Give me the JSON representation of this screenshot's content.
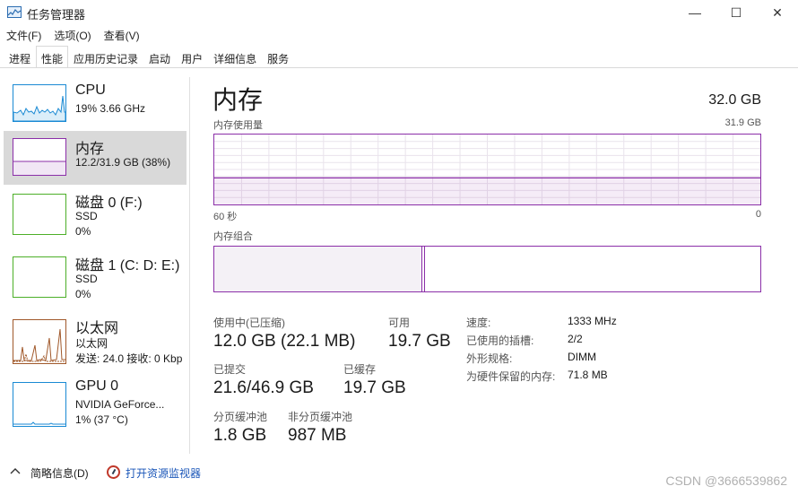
{
  "window": {
    "title": "任务管理器",
    "min_glyph": "—",
    "max_glyph": "☐",
    "close_glyph": "✕"
  },
  "menu": [
    "文件(F)",
    "选项(O)",
    "查看(V)"
  ],
  "tabs": [
    "进程",
    "性能",
    "应用历史记录",
    "启动",
    "用户",
    "详细信息",
    "服务"
  ],
  "active_tab": "性能",
  "sidebar": {
    "items": [
      {
        "title": "CPU",
        "lines": [
          "19% 3.66 GHz"
        ],
        "color": "#1a8ad4"
      },
      {
        "title": "内存",
        "lines": [
          "12.2/31.9 GB (38%)"
        ],
        "color": "#8b2fa8"
      },
      {
        "title": "磁盘 0 (F:)",
        "lines": [
          "SSD",
          "0%"
        ],
        "color": "#4caf28"
      },
      {
        "title": "磁盘 1 (C: D: E:)",
        "lines": [
          "SSD",
          "0%"
        ],
        "color": "#4caf28"
      },
      {
        "title": "以太网",
        "lines": [
          "以太网",
          "发送: 24.0  接收: 0 Kbp"
        ],
        "color": "#a0582a"
      },
      {
        "title": "GPU 0",
        "lines": [
          "NVIDIA GeForce...",
          "1% (37 °C)"
        ],
        "color": "#1a8ad4"
      }
    ],
    "selected": 1
  },
  "memory": {
    "title": "内存",
    "total": "32.0 GB",
    "usage_label": "内存使用量",
    "usage_max": "31.9 GB",
    "time_left": "60 秒",
    "time_right": "0",
    "usage_fraction": 0.38,
    "composition_label": "内存组合",
    "in_use_label": "使用中(已压缩)",
    "in_use_value": "12.0 GB (22.1 MB)",
    "available_label": "可用",
    "available_value": "19.7 GB",
    "committed_label": "已提交",
    "committed_value": "21.6/46.9 GB",
    "cached_label": "已缓存",
    "cached_value": "19.7 GB",
    "paged_label": "分页缓冲池",
    "paged_value": "1.8 GB",
    "nonpaged_label": "非分页缓冲池",
    "nonpaged_value": "987 MB",
    "info": [
      {
        "label": "速度:",
        "value": "1333 MHz"
      },
      {
        "label": "已使用的插槽:",
        "value": "2/2"
      },
      {
        "label": "外形规格:",
        "value": "DIMM"
      },
      {
        "label": "为硬件保留的内存:",
        "value": "71.8 MB"
      }
    ]
  },
  "footer": {
    "summary": "简略信息(D)",
    "monitor_link": "打开资源监视器"
  },
  "watermark": "CSDN @3666539862"
}
